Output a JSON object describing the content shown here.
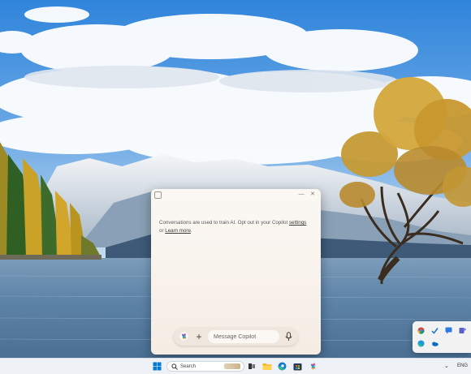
{
  "copilot": {
    "notice_text": "Conversations are used to train AI. Opt out in your Copilot",
    "settings_link": "settings",
    "or_text": "or",
    "learn_more_link": "Learn more",
    "period": ".",
    "input_placeholder": "Message Copilot",
    "minimize_glyph": "—",
    "close_glyph": "✕"
  },
  "taskbar": {
    "search_label": "Search",
    "language": "ENG",
    "overflow_glyph": "⌄"
  },
  "icons": {
    "start": "windows-start-icon",
    "search": "search-icon",
    "task_view": "task-view-icon",
    "file_explorer": "file-explorer-icon",
    "edge": "edge-browser-icon",
    "store": "microsoft-store-icon",
    "copilot": "copilot-icon",
    "microphone": "microphone-icon",
    "add": "plus-icon"
  },
  "colors": {
    "sky": "#3e8ee0",
    "water": "#5d86ad",
    "window_bg": "#fbf8f4",
    "taskbar_bg": "#eef2f6"
  }
}
